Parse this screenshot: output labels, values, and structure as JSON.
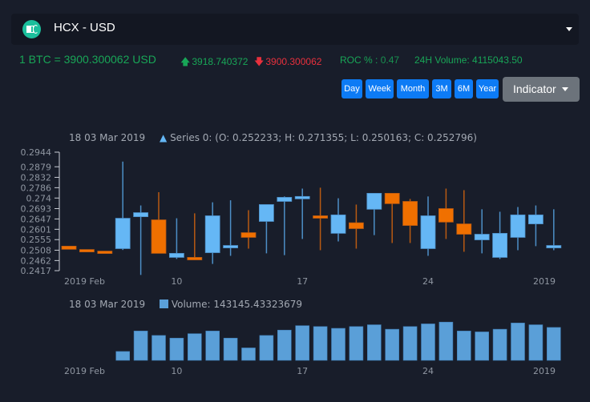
{
  "header": {
    "pair_title": "HCX - USD",
    "logo_icon": "hcx-coin-logo"
  },
  "stats": {
    "rate": "1 BTC = 3900.300062 USD",
    "high": "3918.740372",
    "low": "3900.300062",
    "roc_label": "ROC % :",
    "roc_value": "0.47",
    "volume_24h": "24H Volume: 4115043.50"
  },
  "range_buttons": [
    "Day",
    "Week",
    "Month",
    "3M",
    "6M",
    "Year"
  ],
  "indicator_button": "Indicator",
  "colors": {
    "up": "#65b7f5",
    "down": "#f07000",
    "volume": "#5a9fd8",
    "stat_green": "#18a657",
    "stat_red": "#e8303d",
    "button_blue": "#0d7bf5"
  },
  "chart_data": [
    {
      "type": "candlestick",
      "legend": {
        "date": "18 03 Mar 2019",
        "series_text": "Series 0: (O: 0.252233; H: 0.271355; L: 0.250163; C: 0.252796)"
      },
      "y_ticks": [
        "0.2944",
        "0.2879",
        "0.2832",
        "0.2786",
        "0.274",
        "0.2693",
        "0.2647",
        "0.2601",
        "0.2555",
        "0.2508",
        "0.2462",
        "0.2417"
      ],
      "ylim": [
        0.2417,
        0.2944
      ],
      "x_ticks": [
        {
          "label": "2019 Feb",
          "index": 0
        },
        {
          "label": "10",
          "index": 6
        },
        {
          "label": "17",
          "index": 13
        },
        {
          "label": "24",
          "index": 20
        },
        {
          "label": "2019",
          "index": 27
        }
      ],
      "candles": [
        {
          "o": 0.2526,
          "h": 0.2526,
          "l": 0.2512,
          "c": 0.2512
        },
        {
          "o": 0.2511,
          "h": 0.2511,
          "l": 0.2504,
          "c": 0.2504
        },
        {
          "o": 0.2504,
          "h": 0.2504,
          "l": 0.2497,
          "c": 0.2497
        },
        {
          "o": 0.2515,
          "h": 0.2902,
          "l": 0.2509,
          "c": 0.265
        },
        {
          "o": 0.2657,
          "h": 0.2707,
          "l": 0.2398,
          "c": 0.2675
        },
        {
          "o": 0.2643,
          "h": 0.2766,
          "l": 0.2494,
          "c": 0.2494
        },
        {
          "o": 0.2476,
          "h": 0.265,
          "l": 0.2469,
          "c": 0.2494
        },
        {
          "o": 0.2476,
          "h": 0.2672,
          "l": 0.2465,
          "c": 0.2465
        },
        {
          "o": 0.2497,
          "h": 0.2721,
          "l": 0.2447,
          "c": 0.2661
        },
        {
          "o": 0.2522,
          "h": 0.273,
          "l": 0.2483,
          "c": 0.2529
        },
        {
          "o": 0.2586,
          "h": 0.2686,
          "l": 0.2515,
          "c": 0.2565
        },
        {
          "o": 0.2636,
          "h": 0.2686,
          "l": 0.2494,
          "c": 0.2711
        },
        {
          "o": 0.2725,
          "h": 0.2747,
          "l": 0.2486,
          "c": 0.2743
        },
        {
          "o": 0.2743,
          "h": 0.2782,
          "l": 0.2558,
          "c": 0.2747
        },
        {
          "o": 0.2661,
          "h": 0.2786,
          "l": 0.2508,
          "c": 0.2654
        },
        {
          "o": 0.2583,
          "h": 0.2739,
          "l": 0.2547,
          "c": 0.2665
        },
        {
          "o": 0.263,
          "h": 0.2711,
          "l": 0.2515,
          "c": 0.2604
        },
        {
          "o": 0.269,
          "h": 0.2761,
          "l": 0.2575,
          "c": 0.2761
        },
        {
          "o": 0.2761,
          "h": 0.2761,
          "l": 0.254,
          "c": 0.2715
        },
        {
          "o": 0.2725,
          "h": 0.2736,
          "l": 0.254,
          "c": 0.2618
        },
        {
          "o": 0.2515,
          "h": 0.2747,
          "l": 0.2483,
          "c": 0.2661
        },
        {
          "o": 0.2693,
          "h": 0.2782,
          "l": 0.2558,
          "c": 0.2633
        },
        {
          "o": 0.2625,
          "h": 0.2775,
          "l": 0.2501,
          "c": 0.2579
        },
        {
          "o": 0.2554,
          "h": 0.269,
          "l": 0.2494,
          "c": 0.2579
        },
        {
          "o": 0.2476,
          "h": 0.2679,
          "l": 0.2469,
          "c": 0.2583
        },
        {
          "o": 0.2565,
          "h": 0.27,
          "l": 0.2508,
          "c": 0.2665
        },
        {
          "o": 0.2625,
          "h": 0.2707,
          "l": 0.2526,
          "c": 0.2665
        },
        {
          "o": 0.2526,
          "h": 0.269,
          "l": 0.2508,
          "c": 0.2529
        }
      ]
    },
    {
      "type": "bar",
      "legend": {
        "date": "18 03 Mar 2019",
        "series_text": "Volume: 143145.43323679"
      },
      "x_ticks": [
        {
          "label": "2019 Feb",
          "index": 0
        },
        {
          "label": "10",
          "index": 6
        },
        {
          "label": "17",
          "index": 13
        },
        {
          "label": "24",
          "index": 20
        },
        {
          "label": "2019",
          "index": 27
        }
      ],
      "start_index": 3,
      "values": [
        10,
        33,
        28,
        25,
        30,
        33,
        25,
        14,
        28,
        34,
        39,
        38,
        36,
        38,
        40,
        35,
        38,
        41,
        43,
        33,
        32,
        35,
        42,
        40,
        37
      ],
      "ymax": 45
    }
  ]
}
